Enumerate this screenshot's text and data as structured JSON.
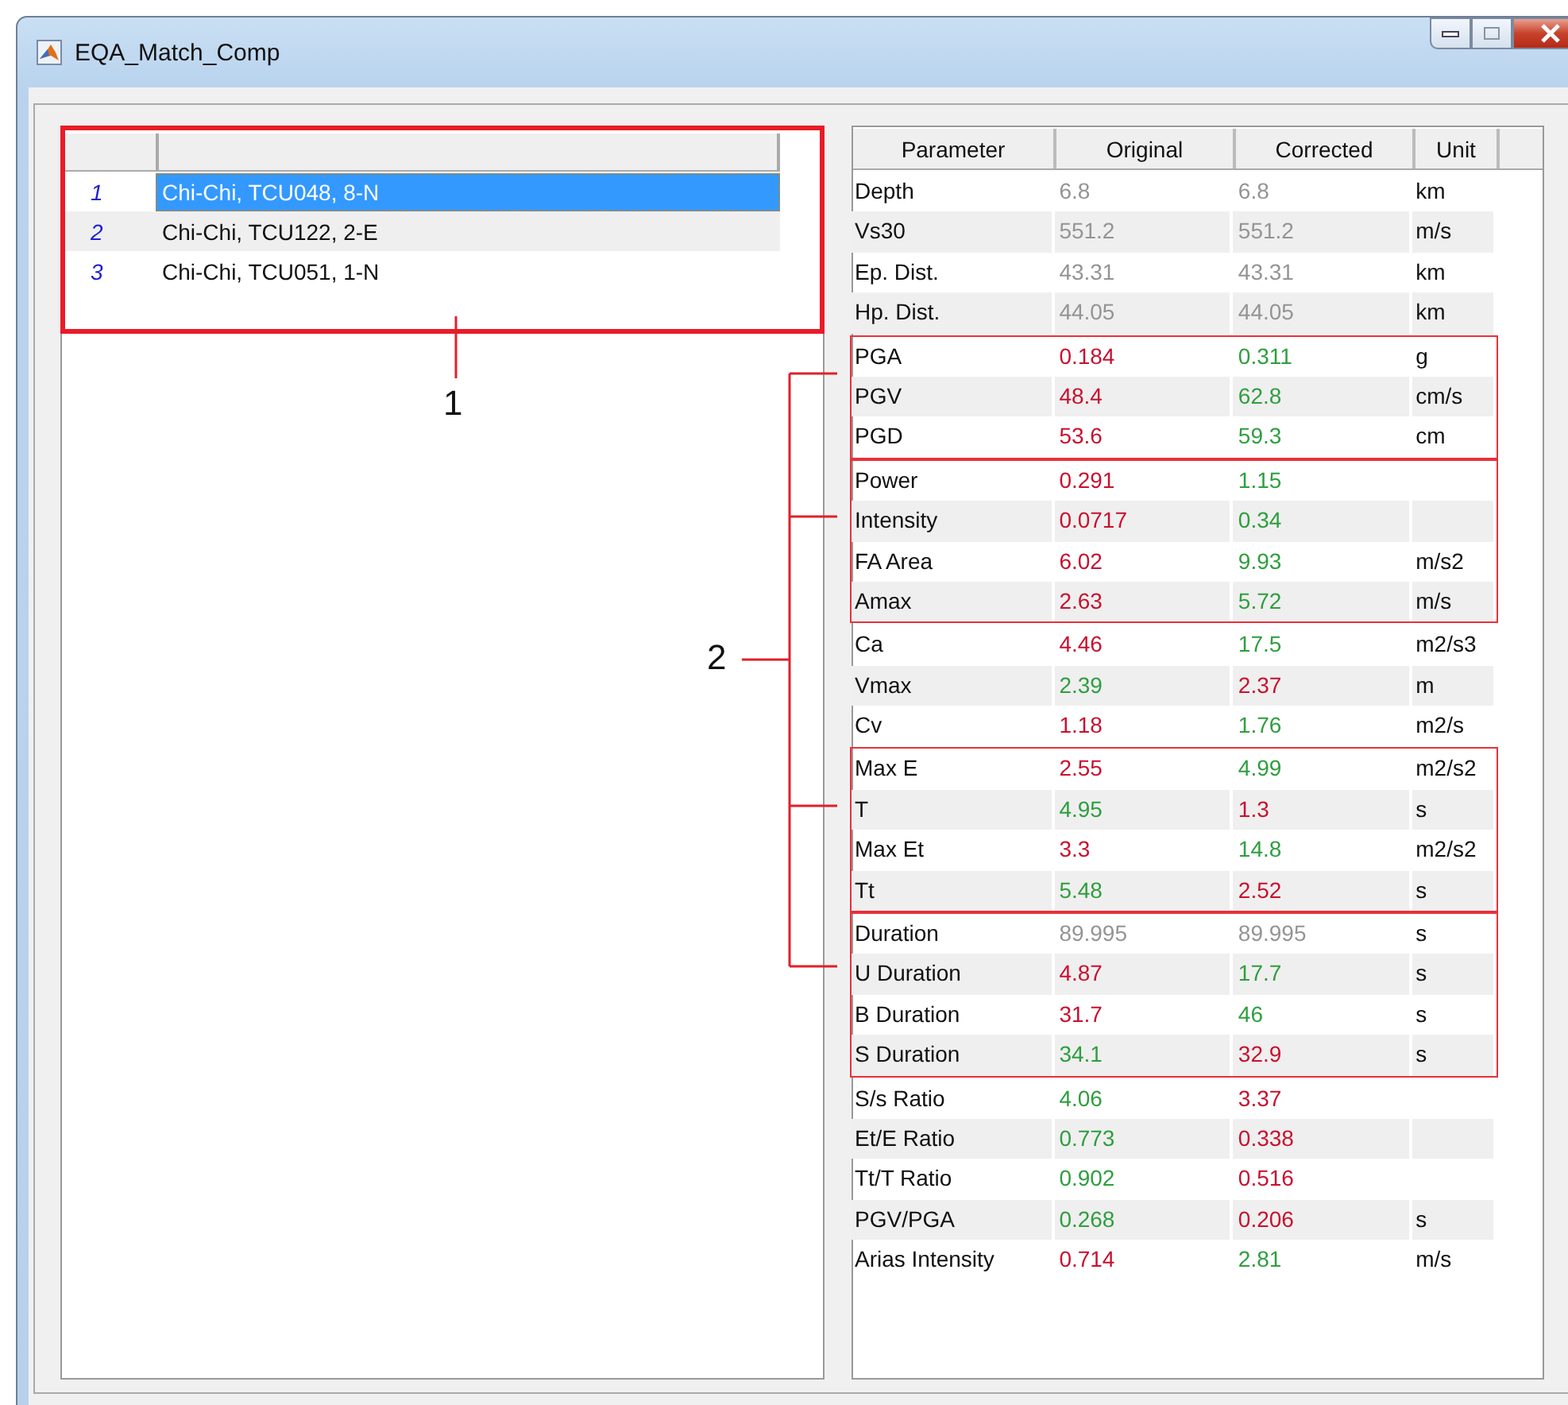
{
  "window": {
    "title": "EQA_Match_Comp"
  },
  "record_list": {
    "highlighted": true,
    "rows": [
      {
        "number": "1",
        "name": "Chi-Chi, TCU048, 8-N",
        "selected": true
      },
      {
        "number": "2",
        "name": "Chi-Chi, TCU122, 2-E",
        "selected": false
      },
      {
        "number": "3",
        "name": "Chi-Chi, TCU051, 1-N",
        "selected": false
      }
    ]
  },
  "table": {
    "columns": [
      "Parameter",
      "Original",
      "Corrected",
      "Unit"
    ],
    "row_groups": [
      {
        "boxed": false,
        "rows": [
          {
            "parameter": "Depth",
            "original": {
              "text": "6.8",
              "color": "#949494"
            },
            "corrected": {
              "text": "6.8",
              "color": "#949494"
            },
            "unit": "km"
          },
          {
            "parameter": "Vs30",
            "original": {
              "text": "551.2",
              "color": "#949494"
            },
            "corrected": {
              "text": "551.2",
              "color": "#949494"
            },
            "unit": "m/s"
          },
          {
            "parameter": "Ep. Dist.",
            "original": {
              "text": "43.31",
              "color": "#949494"
            },
            "corrected": {
              "text": "43.31",
              "color": "#949494"
            },
            "unit": "km"
          },
          {
            "parameter": "Hp. Dist.",
            "original": {
              "text": "44.05",
              "color": "#949494"
            },
            "corrected": {
              "text": "44.05",
              "color": "#949494"
            },
            "unit": "km"
          }
        ]
      },
      {
        "boxed": true,
        "rows": [
          {
            "parameter": "PGA",
            "original": {
              "text": "0.184",
              "color": "#c8102e"
            },
            "corrected": {
              "text": "0.311",
              "color": "#2e9e3e"
            },
            "unit": "g"
          },
          {
            "parameter": "PGV",
            "original": {
              "text": "48.4",
              "color": "#c8102e"
            },
            "corrected": {
              "text": "62.8",
              "color": "#2e9e3e"
            },
            "unit": "cm/s"
          },
          {
            "parameter": "PGD",
            "original": {
              "text": "53.6",
              "color": "#c8102e"
            },
            "corrected": {
              "text": "59.3",
              "color": "#2e9e3e"
            },
            "unit": "cm"
          }
        ]
      },
      {
        "boxed": true,
        "rows": [
          {
            "parameter": "Power",
            "original": {
              "text": "0.291",
              "color": "#c8102e"
            },
            "corrected": {
              "text": "1.15",
              "color": "#2e9e3e"
            }
          },
          {
            "parameter": "Intensity",
            "original": {
              "text": "0.0717",
              "color": "#c8102e"
            },
            "corrected": {
              "text": "0.34",
              "color": "#2e9e3e"
            }
          },
          {
            "parameter": "FA Area",
            "original": {
              "text": "6.02",
              "color": "#c8102e"
            },
            "corrected": {
              "text": "9.93",
              "color": "#2e9e3e"
            },
            "unit": "m/s2"
          },
          {
            "parameter": "Amax",
            "original": {
              "text": "2.63",
              "color": "#c8102e"
            },
            "corrected": {
              "text": "5.72",
              "color": "#2e9e3e"
            },
            "unit": "m/s"
          }
        ]
      },
      {
        "boxed": false,
        "rows": [
          {
            "parameter": "Ca",
            "original": {
              "text": "4.46",
              "color": "#c8102e"
            },
            "corrected": {
              "text": "17.5",
              "color": "#2e9e3e"
            },
            "unit": "m2/s3"
          },
          {
            "parameter": "Vmax",
            "original": {
              "text": "2.39",
              "color": "#2e9e3e"
            },
            "corrected": {
              "text": "2.37",
              "color": "#c8102e"
            },
            "unit": "m"
          },
          {
            "parameter": "Cv",
            "original": {
              "text": "1.18",
              "color": "#c8102e"
            },
            "corrected": {
              "text": "1.76",
              "color": "#2e9e3e"
            },
            "unit": "m2/s"
          }
        ]
      },
      {
        "boxed": true,
        "rows": [
          {
            "parameter": "Max E",
            "original": {
              "text": "2.55",
              "color": "#c8102e"
            },
            "corrected": {
              "text": "4.99",
              "color": "#2e9e3e"
            },
            "unit": "m2/s2"
          },
          {
            "parameter": "T",
            "original": {
              "text": "4.95",
              "color": "#2e9e3e"
            },
            "corrected": {
              "text": "1.3",
              "color": "#c8102e"
            },
            "unit": "s"
          },
          {
            "parameter": "Max Et",
            "original": {
              "text": "3.3",
              "color": "#c8102e"
            },
            "corrected": {
              "text": "14.8",
              "color": "#2e9e3e"
            },
            "unit": "m2/s2"
          },
          {
            "parameter": "Tt",
            "original": {
              "text": "5.48",
              "color": "#2e9e3e"
            },
            "corrected": {
              "text": "2.52",
              "color": "#c8102e"
            },
            "unit": "s"
          }
        ]
      },
      {
        "boxed": true,
        "rows": [
          {
            "parameter": "Duration",
            "original": {
              "text": "89.995",
              "color": "#949494"
            },
            "corrected": {
              "text": "89.995",
              "color": "#949494"
            },
            "unit": "s"
          },
          {
            "parameter": "U Duration",
            "original": {
              "text": "4.87",
              "color": "#c8102e"
            },
            "corrected": {
              "text": "17.7",
              "color": "#2e9e3e"
            },
            "unit": "s"
          },
          {
            "parameter": "B Duration",
            "original": {
              "text": "31.7",
              "color": "#c8102e"
            },
            "corrected": {
              "text": "46",
              "color": "#2e9e3e"
            },
            "unit": "s"
          },
          {
            "parameter": "S Duration",
            "original": {
              "text": "34.1",
              "color": "#2e9e3e"
            },
            "corrected": {
              "text": "32.9",
              "color": "#c8102e"
            },
            "unit": "s"
          }
        ]
      },
      {
        "boxed": false,
        "rows": [
          {
            "parameter": "S/s Ratio",
            "original": {
              "text": "4.06",
              "color": "#2e9e3e"
            },
            "corrected": {
              "text": "3.37",
              "color": "#c8102e"
            }
          },
          {
            "parameter": "Et/E Ratio",
            "original": {
              "text": "0.773",
              "color": "#2e9e3e"
            },
            "corrected": {
              "text": "0.338",
              "color": "#c8102e"
            }
          },
          {
            "parameter": "Tt/T Ratio",
            "original": {
              "text": "0.902",
              "color": "#2e9e3e"
            },
            "corrected": {
              "text": "0.516",
              "color": "#c8102e"
            }
          },
          {
            "parameter": "PGV/PGA",
            "original": {
              "text": "0.268",
              "color": "#2e9e3e"
            },
            "corrected": {
              "text": "0.206",
              "color": "#c8102e"
            },
            "unit": "s"
          },
          {
            "parameter": "Arias Intensity",
            "original": {
              "text": "0.714",
              "color": "#c8102e"
            },
            "corrected": {
              "text": "2.81",
              "color": "#2e9e3e"
            },
            "unit": "m/s"
          }
        ]
      }
    ]
  },
  "callouts": [
    {
      "label": "1"
    },
    {
      "label": "2"
    }
  ]
}
